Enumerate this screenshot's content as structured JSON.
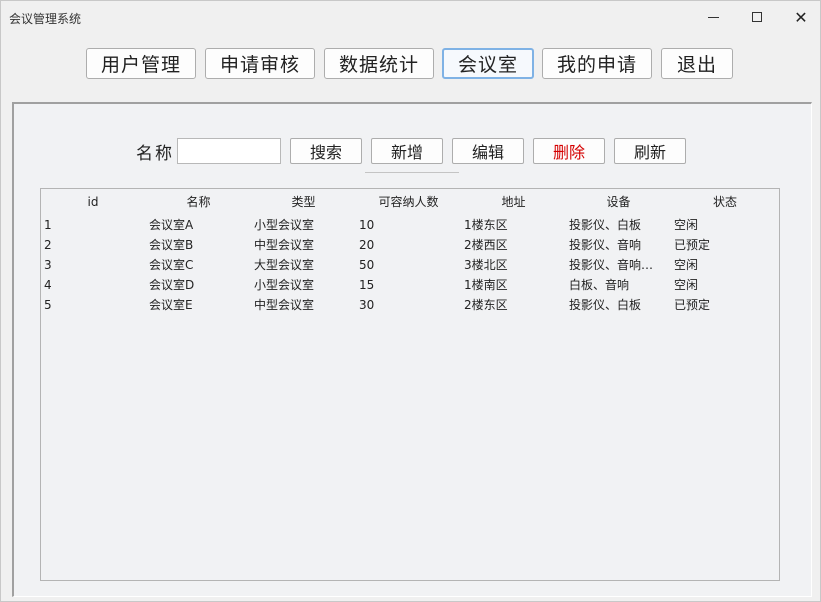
{
  "window": {
    "title": "会议管理系统",
    "minimize_label": "",
    "maximize_label": "",
    "close_label": "✕"
  },
  "nav": {
    "items": [
      {
        "label": "用户管理",
        "active": false
      },
      {
        "label": "申请审核",
        "active": false
      },
      {
        "label": "数据统计",
        "active": false
      },
      {
        "label": "会议室",
        "active": true
      },
      {
        "label": "我的申请",
        "active": false
      },
      {
        "label": "退出",
        "active": false
      }
    ]
  },
  "toolbar": {
    "name_label": "名称",
    "name_value": "",
    "search_label": "搜索",
    "add_label": "新增",
    "edit_label": "编辑",
    "delete_label": "删除",
    "refresh_label": "刷新",
    "delete_color": "#d40000"
  },
  "table": {
    "columns": [
      "id",
      "名称",
      "类型",
      "可容纳人数",
      "地址",
      "设备",
      "状态"
    ],
    "rows": [
      [
        "1",
        "会议室A",
        "小型会议室",
        "10",
        "1楼东区",
        "投影仪、白板",
        "空闲"
      ],
      [
        "2",
        "会议室B",
        "中型会议室",
        "20",
        "2楼西区",
        "投影仪、音响",
        "已预定"
      ],
      [
        "3",
        "会议室C",
        "大型会议室",
        "50",
        "3楼北区",
        "投影仪、音响、...",
        "空闲"
      ],
      [
        "4",
        "会议室D",
        "小型会议室",
        "15",
        "1楼南区",
        "白板、音响",
        "空闲"
      ],
      [
        "5",
        "会议室E",
        "中型会议室",
        "30",
        "2楼东区",
        "投影仪、白板",
        "已预定"
      ]
    ]
  },
  "colors": {
    "active_tab_border": "#7fb2e5",
    "background": "#f0f0f0"
  }
}
